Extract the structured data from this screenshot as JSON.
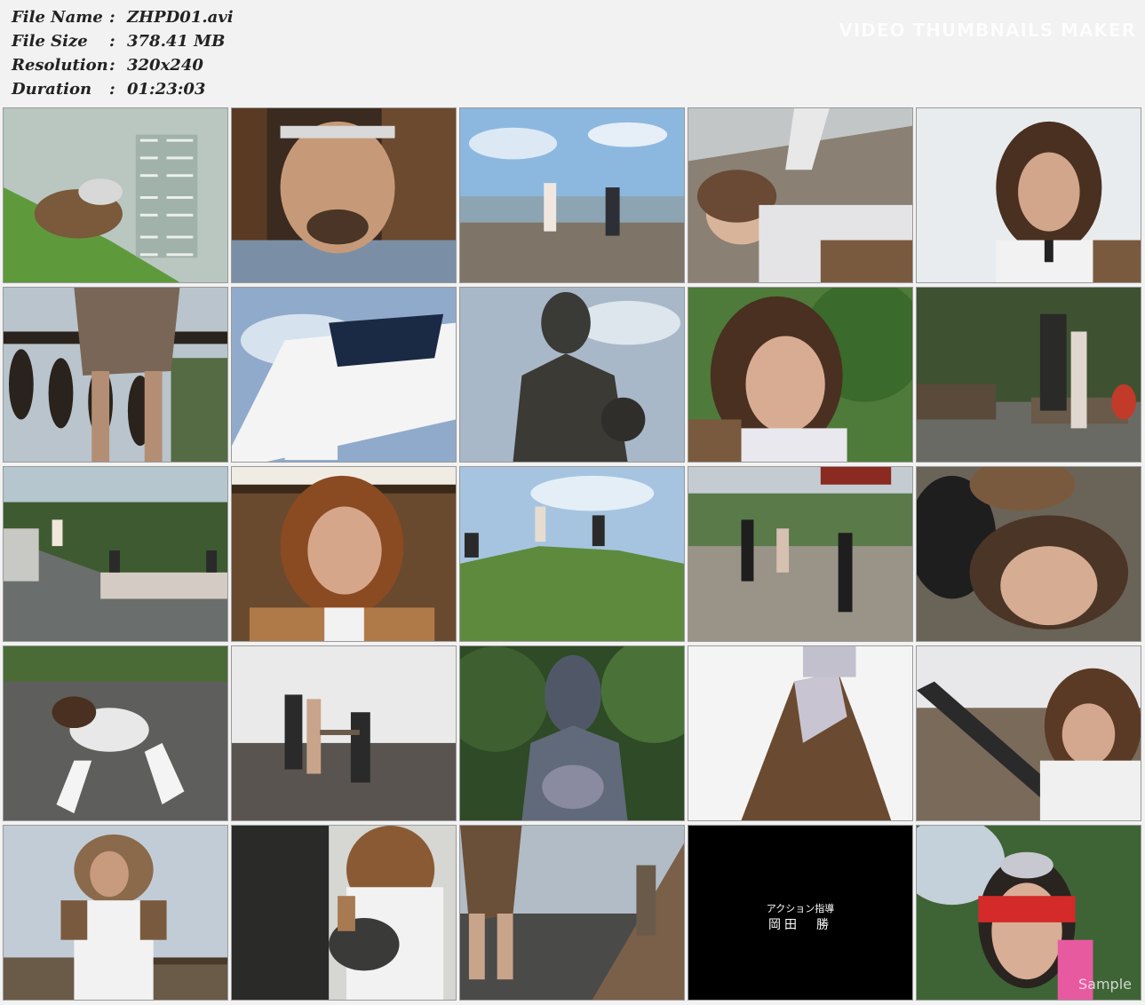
{
  "file_info": {
    "name_label": "File Name",
    "name_value": "ZHPD01.avi",
    "size_label": "File Size",
    "size_value": "378.41 MB",
    "resolution_label": "Resolution",
    "resolution_value": "320x240",
    "duration_label": "Duration",
    "duration_value": "01:23:03",
    "separator": ":"
  },
  "watermark": "VIDEO THUMBNAILS MAKER",
  "thumbnails": {
    "credits_frame": {
      "line1": "アクション指導",
      "line2": "岡田　勝"
    },
    "sample_mark": "Sample"
  }
}
